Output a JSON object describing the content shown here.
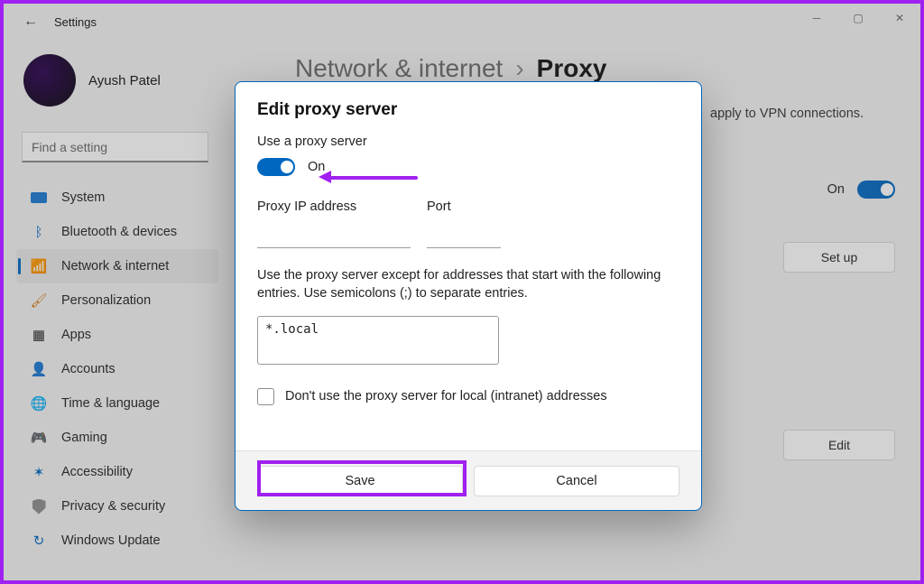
{
  "app": {
    "title": "Settings"
  },
  "user": {
    "name": "Ayush Patel"
  },
  "search": {
    "placeholder": "Find a setting"
  },
  "sidebar": {
    "items": [
      {
        "label": "System"
      },
      {
        "label": "Bluetooth & devices"
      },
      {
        "label": "Network & internet"
      },
      {
        "label": "Personalization"
      },
      {
        "label": "Apps"
      },
      {
        "label": "Accounts"
      },
      {
        "label": "Time & language"
      },
      {
        "label": "Gaming"
      },
      {
        "label": "Accessibility"
      },
      {
        "label": "Privacy & security"
      },
      {
        "label": "Windows Update"
      }
    ],
    "selected_index": 2
  },
  "breadcrumb": {
    "parent": "Network & internet",
    "separator": "›",
    "leaf": "Proxy"
  },
  "main": {
    "note": "apply to VPN connections.",
    "detect": {
      "status": "On"
    },
    "setup_button": "Set up",
    "edit_button": "Edit"
  },
  "modal": {
    "title": "Edit proxy server",
    "use_label": "Use a proxy server",
    "toggle_state": "On",
    "ip_label": "Proxy IP address",
    "ip_value": "",
    "port_label": "Port",
    "port_value": "",
    "exceptions_desc": "Use the proxy server except for addresses that start with the following entries. Use semicolons (;) to separate entries.",
    "exceptions_value": "*.local",
    "checkbox_label": "Don't use the proxy server for local (intranet) addresses",
    "checkbox_checked": false,
    "save_label": "Save",
    "cancel_label": "Cancel"
  },
  "annotation": {
    "highlight_color": "#A020F0"
  }
}
